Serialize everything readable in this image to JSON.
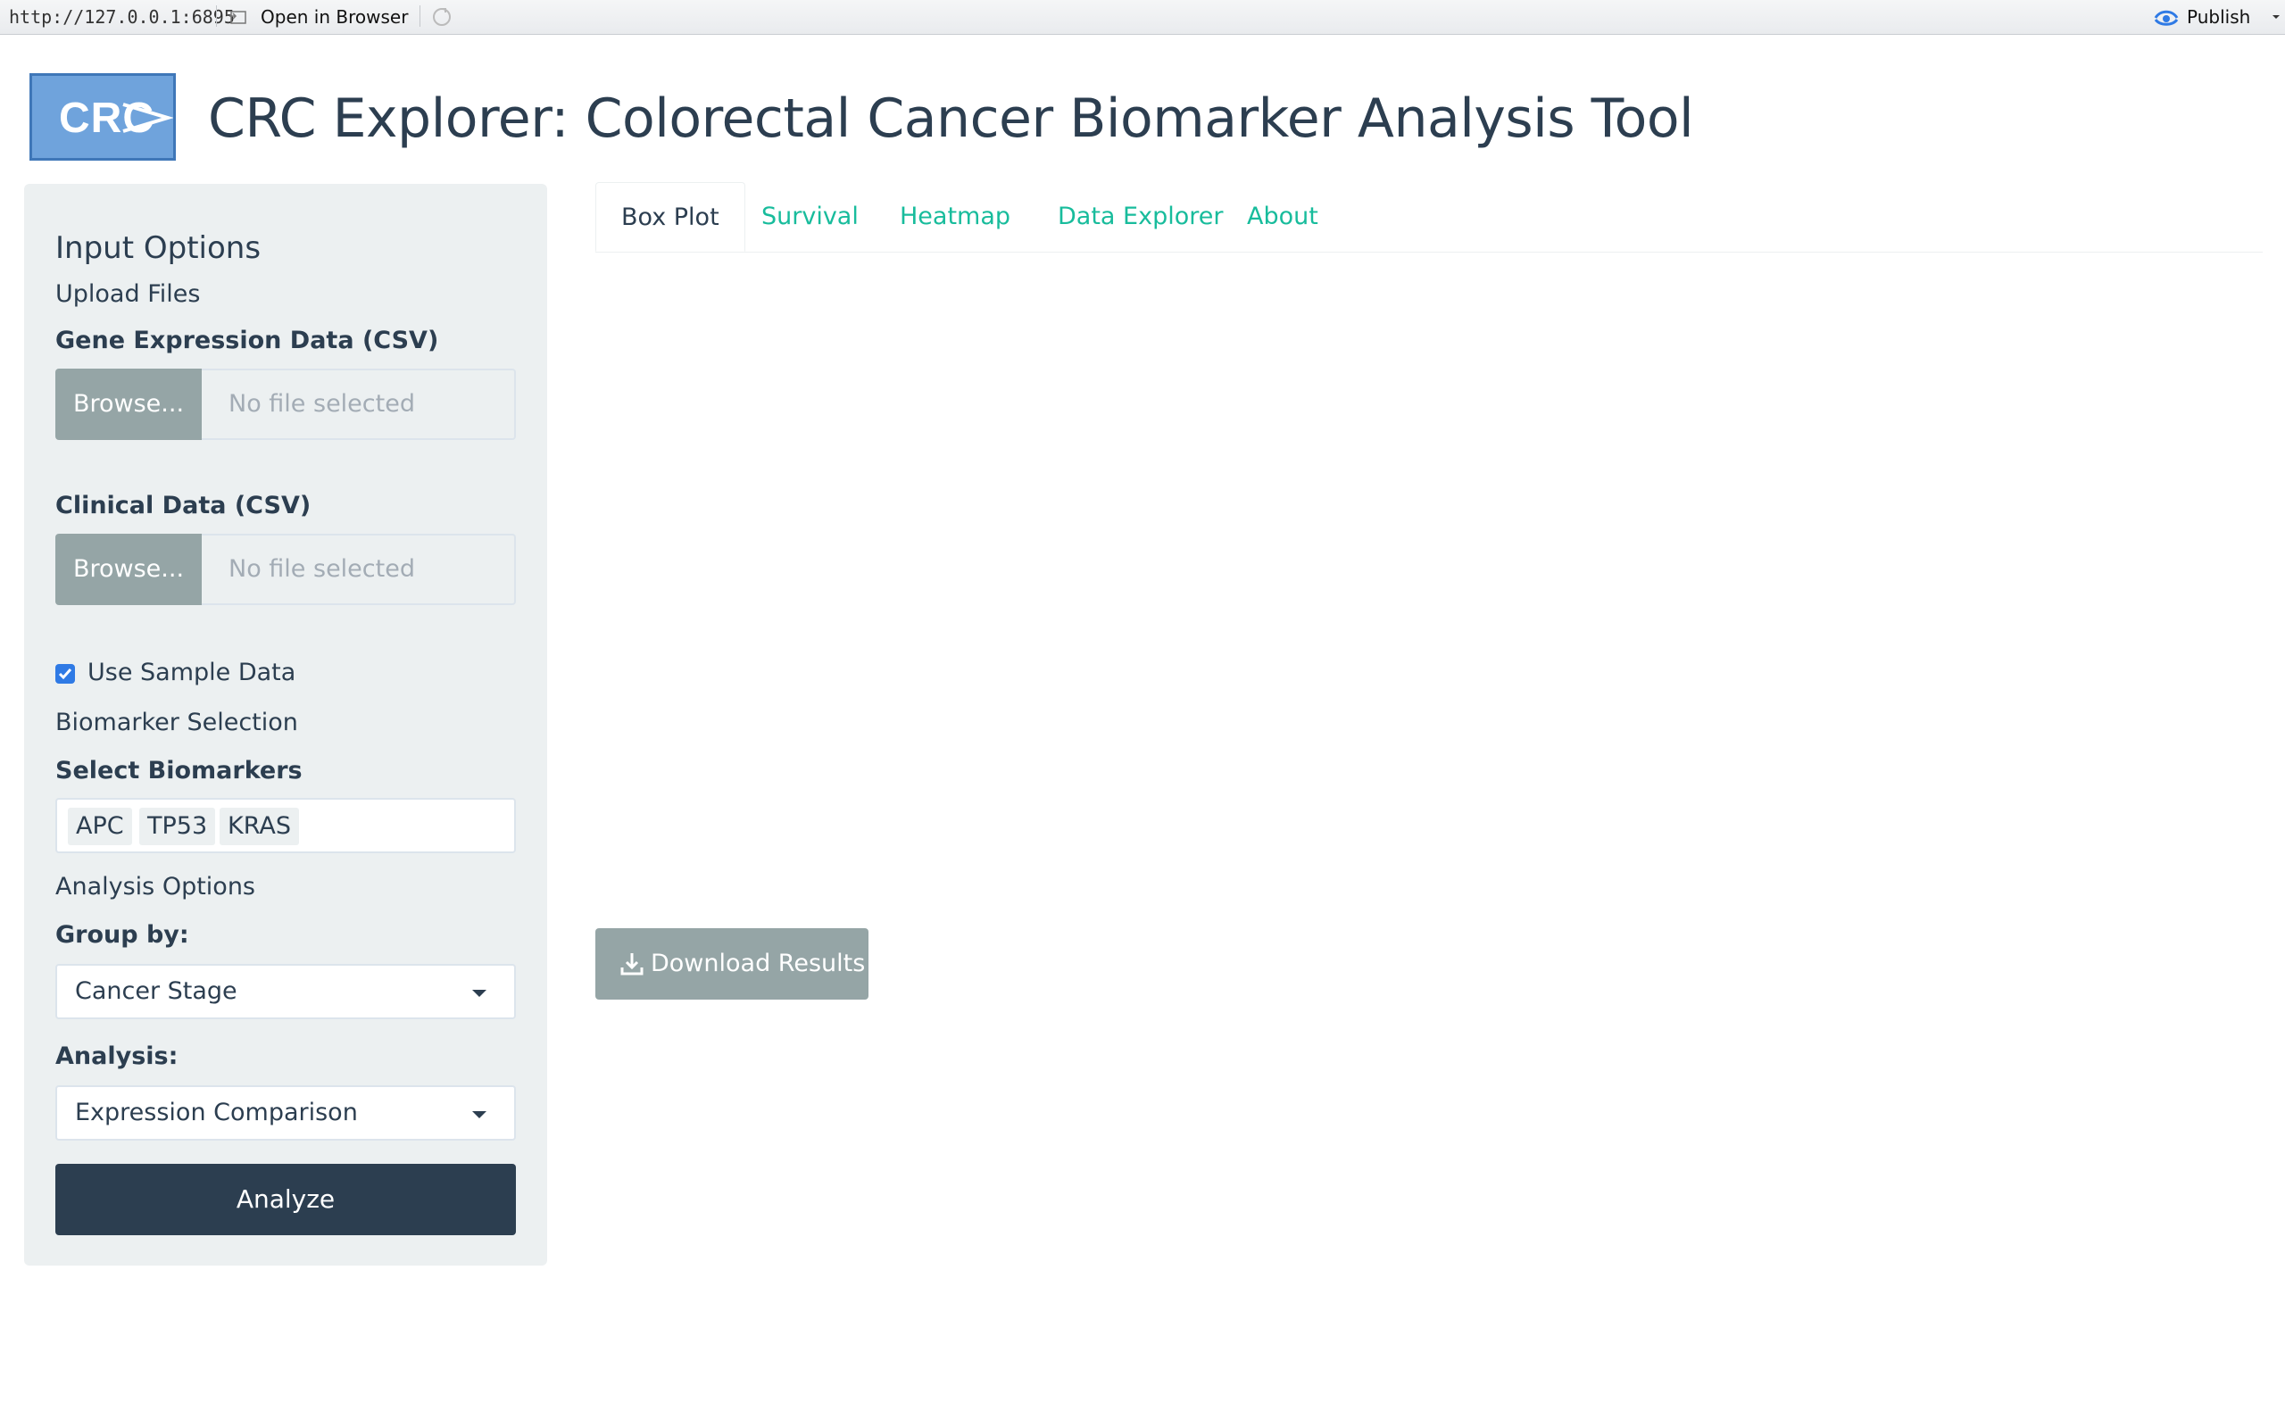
{
  "viewer_bar": {
    "url": "http://127.0.0.1:6895",
    "open_in_browser": "Open in Browser",
    "publish": "Publish"
  },
  "header": {
    "logo_text": "CRC",
    "title": "CRC Explorer: Colorectal Cancer Biomarker Analysis Tool"
  },
  "sidebar": {
    "heading": "Input Options",
    "upload_section": "Upload Files",
    "gene_expression_label": "Gene Expression Data (CSV)",
    "gene_browse": "Browse...",
    "gene_file_placeholder": "No file selected",
    "clinical_label": "Clinical Data (CSV)",
    "clinical_browse": "Browse...",
    "clinical_file_placeholder": "No file selected",
    "use_sample_data": "Use Sample Data",
    "use_sample_data_checked": true,
    "biomarker_section": "Biomarker Selection",
    "select_biomarkers_label": "Select Biomarkers",
    "biomarkers": [
      "APC",
      "TP53",
      "KRAS"
    ],
    "analysis_section": "Analysis Options",
    "group_by_label": "Group by:",
    "group_by_value": "Cancer Stage",
    "analysis_label": "Analysis:",
    "analysis_value": "Expression Comparison",
    "analyze_button": "Analyze"
  },
  "tabs": [
    {
      "label": "Box Plot",
      "active": true
    },
    {
      "label": "Survival",
      "active": false
    },
    {
      "label": "Heatmap",
      "active": false
    },
    {
      "label": "Data Explorer",
      "active": false
    },
    {
      "label": "About",
      "active": false
    }
  ],
  "main": {
    "download_button": "Download Results"
  },
  "colors": {
    "primary": "#2c3e50",
    "link": "#18bc9c",
    "secondary_button": "#95a5a6",
    "sidebar_bg": "#ecf0f1",
    "logo_bg": "#6fa3dc"
  }
}
